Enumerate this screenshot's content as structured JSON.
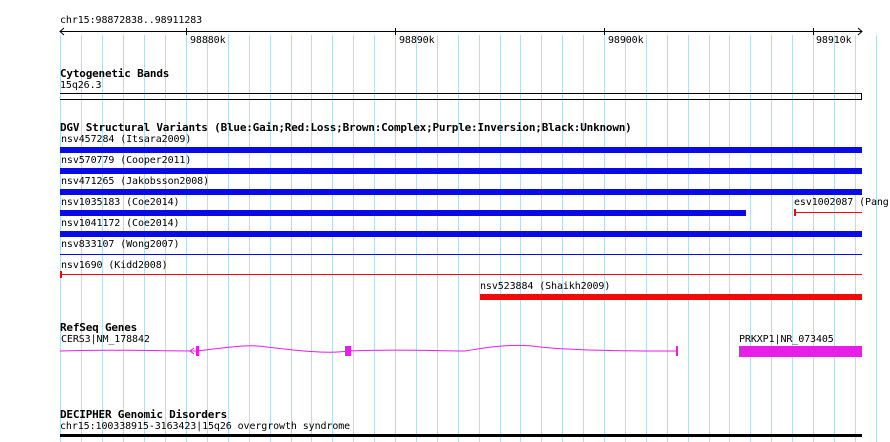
{
  "ruler": {
    "location": "chr15:98872838..98911283",
    "ticks": [
      "98880k",
      "98890k",
      "98900k",
      "98910k"
    ]
  },
  "cytoband": {
    "title": "Cytogenetic Bands",
    "band": "15q26.3"
  },
  "dgv": {
    "title": "DGV Structural Variants (Blue:Gain;Red:Loss;Brown:Complex;Purple:Inversion;Black:Unknown)",
    "colors": {
      "gain": "#0a0ae6",
      "loss": "#f00a0a"
    },
    "variants": [
      {
        "label": "nsv457284 (Itsara2009)",
        "type": "gain"
      },
      {
        "label": "nsv570779 (Cooper2011)",
        "type": "gain"
      },
      {
        "label": "nsv471265 (Jakobsson2008)",
        "type": "gain"
      },
      {
        "label": "nsv1035183 (Coe2014)",
        "type": "gain"
      },
      {
        "label": "esv1002087 (Pang",
        "type": "loss"
      },
      {
        "label": "nsv1041172 (Coe2014)",
        "type": "gain"
      },
      {
        "label": "nsv833107 (Wong2007)",
        "type": "gain"
      },
      {
        "label": "nsv1690 (Kidd2008)",
        "type": "loss"
      },
      {
        "label": "nsv523884 (Shaikh2009)",
        "type": "loss"
      }
    ]
  },
  "refseq": {
    "title": "RefSeq Genes",
    "color": "#e61ee6",
    "genes": [
      "CERS3|NM_178842",
      "PRKXP1|NR_073405"
    ]
  },
  "decipher": {
    "title": "DECIPHER Genomic Disorders",
    "entry": "chr15:100338915-3163423|15q26 overgrowth syndrome"
  }
}
